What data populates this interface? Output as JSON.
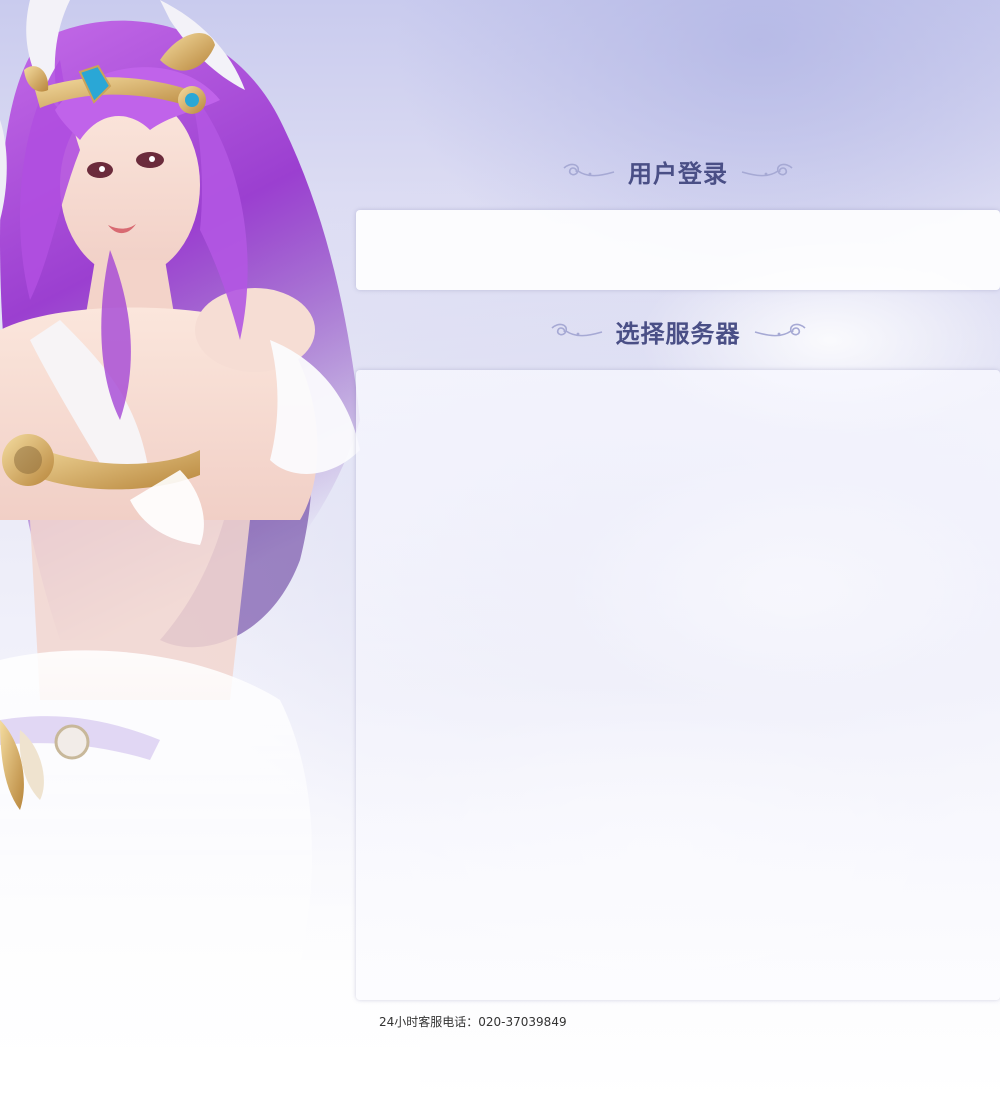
{
  "login_section": {
    "title": "用户登录"
  },
  "server_section": {
    "title": "选择服务器"
  },
  "footer": {
    "hotline": "24小时客服电话：020-37039849"
  },
  "colors": {
    "heading": "#4a4f86",
    "background_top": "#c9cbee",
    "hair": "#a548d6",
    "panel": "#ffffff"
  },
  "icons": {
    "heading_ornament": "scroll-flourish-icon"
  }
}
